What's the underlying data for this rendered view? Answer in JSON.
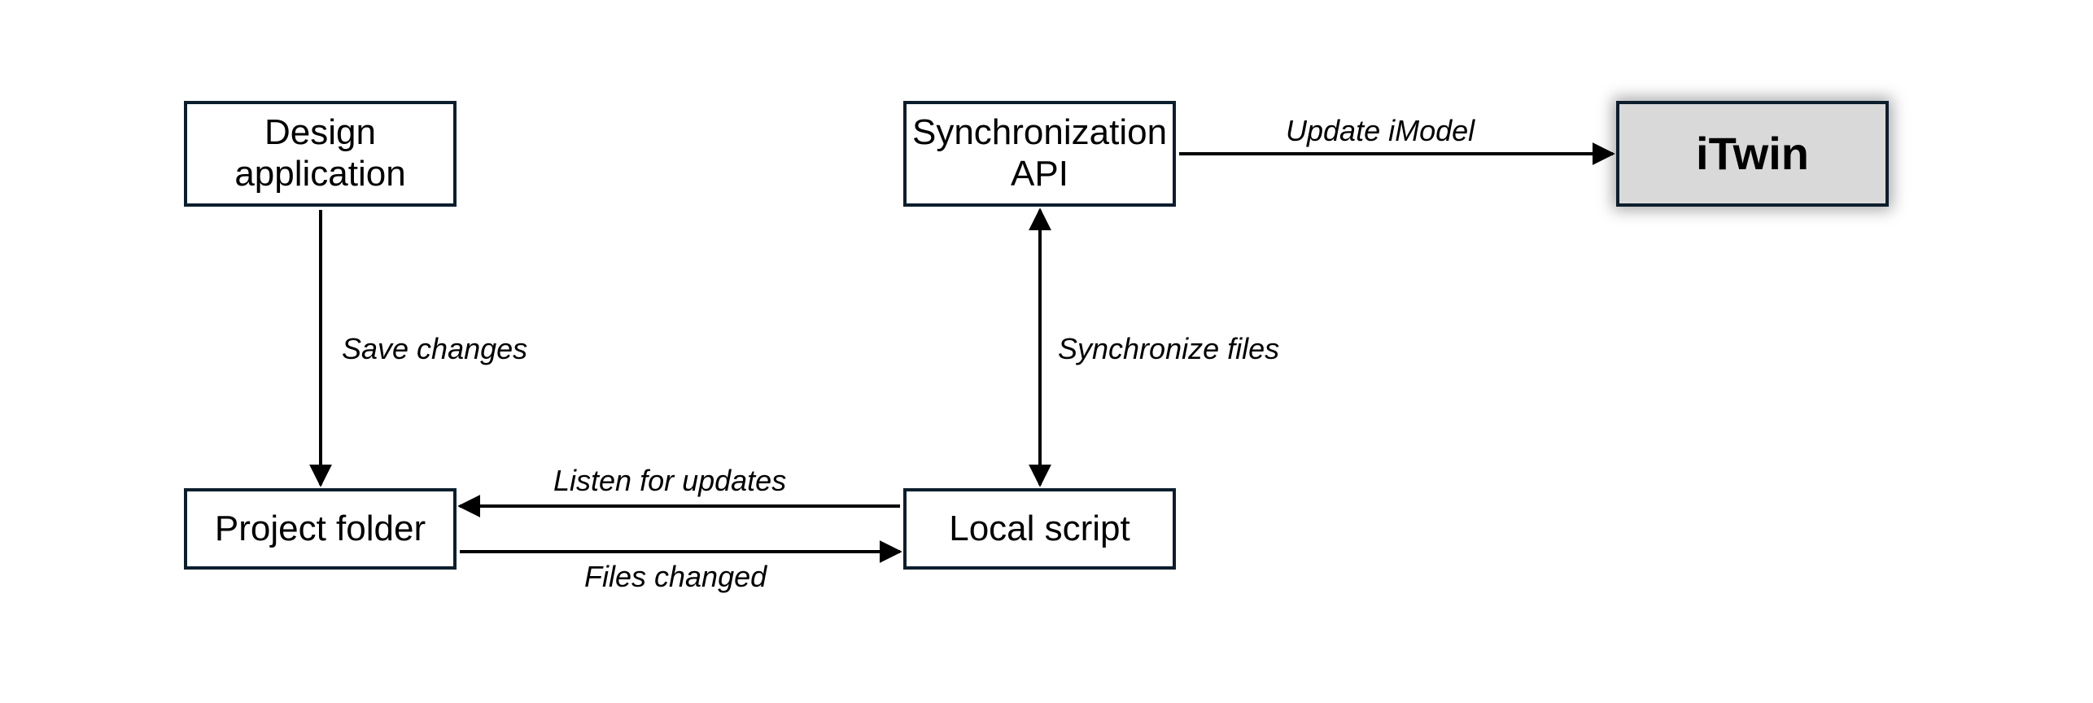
{
  "nodes": {
    "design_app": "Design application",
    "project_folder": "Project  folder",
    "local_script": "Local script",
    "sync_api": "Synchronization API",
    "itwin": "iTwin"
  },
  "edges": {
    "save_changes": "Save changes",
    "listen_for_updates": "Listen for updates",
    "files_changed": "Files changed",
    "synchronize_files": "Synchronize files",
    "update_imodel": "Update iModel"
  }
}
